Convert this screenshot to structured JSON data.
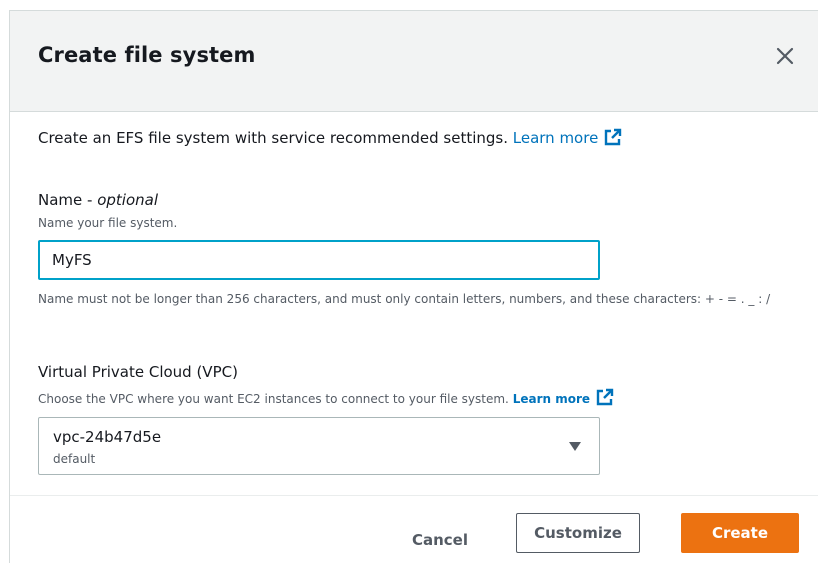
{
  "dialog": {
    "title": "Create file system",
    "close_icon": "close-icon"
  },
  "intro": {
    "text": "Create an EFS file system with service recommended settings. ",
    "learn_more": "Learn more",
    "link_icon": "external-link-icon"
  },
  "name_field": {
    "label": "Name - ",
    "label_optional": "optional",
    "description": "Name your file system.",
    "value": "MyFS",
    "constraint": "Name must not be longer than 256 characters, and must only contain letters, numbers, and these characters: + - = . _ : /"
  },
  "vpc_field": {
    "label": "Virtual Private Cloud (VPC)",
    "description": "Choose the VPC where you want EC2 instances to connect to your file system. ",
    "learn_more": "Learn more",
    "selected_value": "vpc-24b47d5e",
    "selected_description": "default"
  },
  "footer": {
    "cancel_label": "Cancel",
    "customize_label": "Customize",
    "create_label": "Create"
  },
  "colors": {
    "primary_button": "#ec7211",
    "link": "#0073bb",
    "focus_border": "#00a1c9"
  }
}
